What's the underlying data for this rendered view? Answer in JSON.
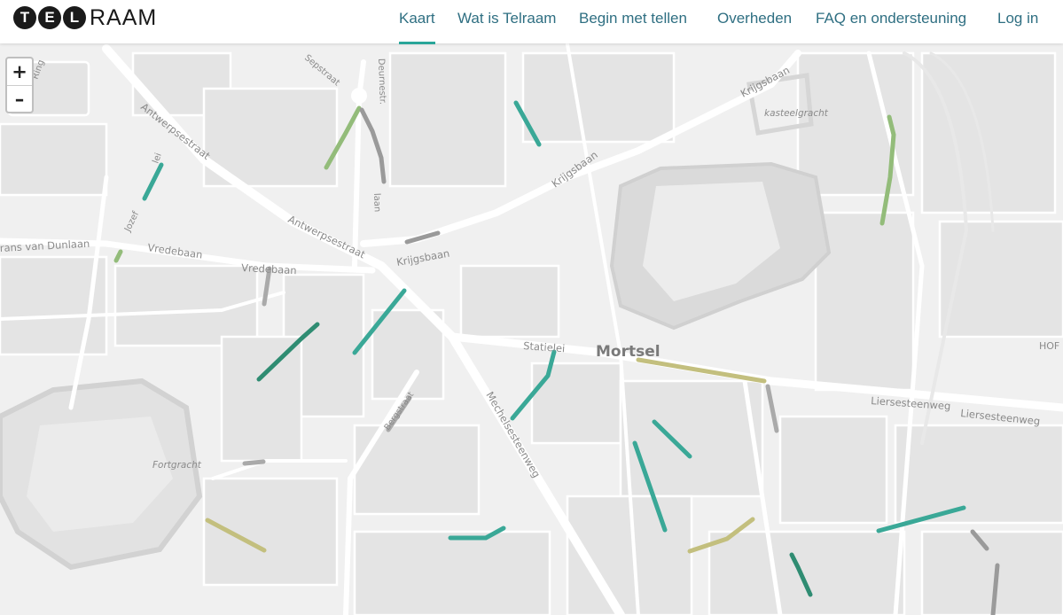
{
  "logo": {
    "circles": [
      "T",
      "E",
      "L"
    ],
    "rest": "RAAM"
  },
  "nav": {
    "kaart": "Kaart",
    "wat_is": "Wat is Telraam",
    "begin": "Begin met tellen",
    "overheden": "Overheden",
    "faq": "FAQ en ondersteuning",
    "login": "Log in"
  },
  "zoom": {
    "in": "+",
    "out": "–"
  },
  "map": {
    "city": "Mortsel",
    "streets": {
      "antwerpsestraat_1": "Antwerpsestraat",
      "antwerpsestraat_2": "Antwerpsestraat",
      "krijgsbaan_1": "Krijgsbaan",
      "krijgsbaan_2": "Krijgsbaan",
      "krijgsbaan_3": "Krijgsbaan",
      "vredebaan_1": "Vredebaan",
      "vredebaan_2": "Vredebaan",
      "frans_van_dunlaan": "rans van Dunlaan",
      "statielei": "Statielei",
      "mechelsesteenweg": "Mechelsesteenweg",
      "liersesteenweg_1": "Liersesteenweg",
      "liersesteenweg_2": "Liersesteenweg",
      "sepstraat": "Sepstraat",
      "deurnestraat": "Deurnestr.",
      "jozef": "Jozef",
      "ring": "Ring",
      "lei": "lei",
      "laan": "laan",
      "bergstraat": "Bergstraat",
      "hof": "HOF"
    },
    "water": {
      "kasteelgracht": "kasteelgracht",
      "fortgracht": "Fortgracht"
    }
  },
  "colors": {
    "teal": "#3aa897",
    "dark_teal": "#2f8c72",
    "light_green": "#93bc7a",
    "olive": "#c3bf7e",
    "grey": "#9a9a9a",
    "nav_text": "#2f6f82",
    "nav_accent": "#2aa69a"
  }
}
